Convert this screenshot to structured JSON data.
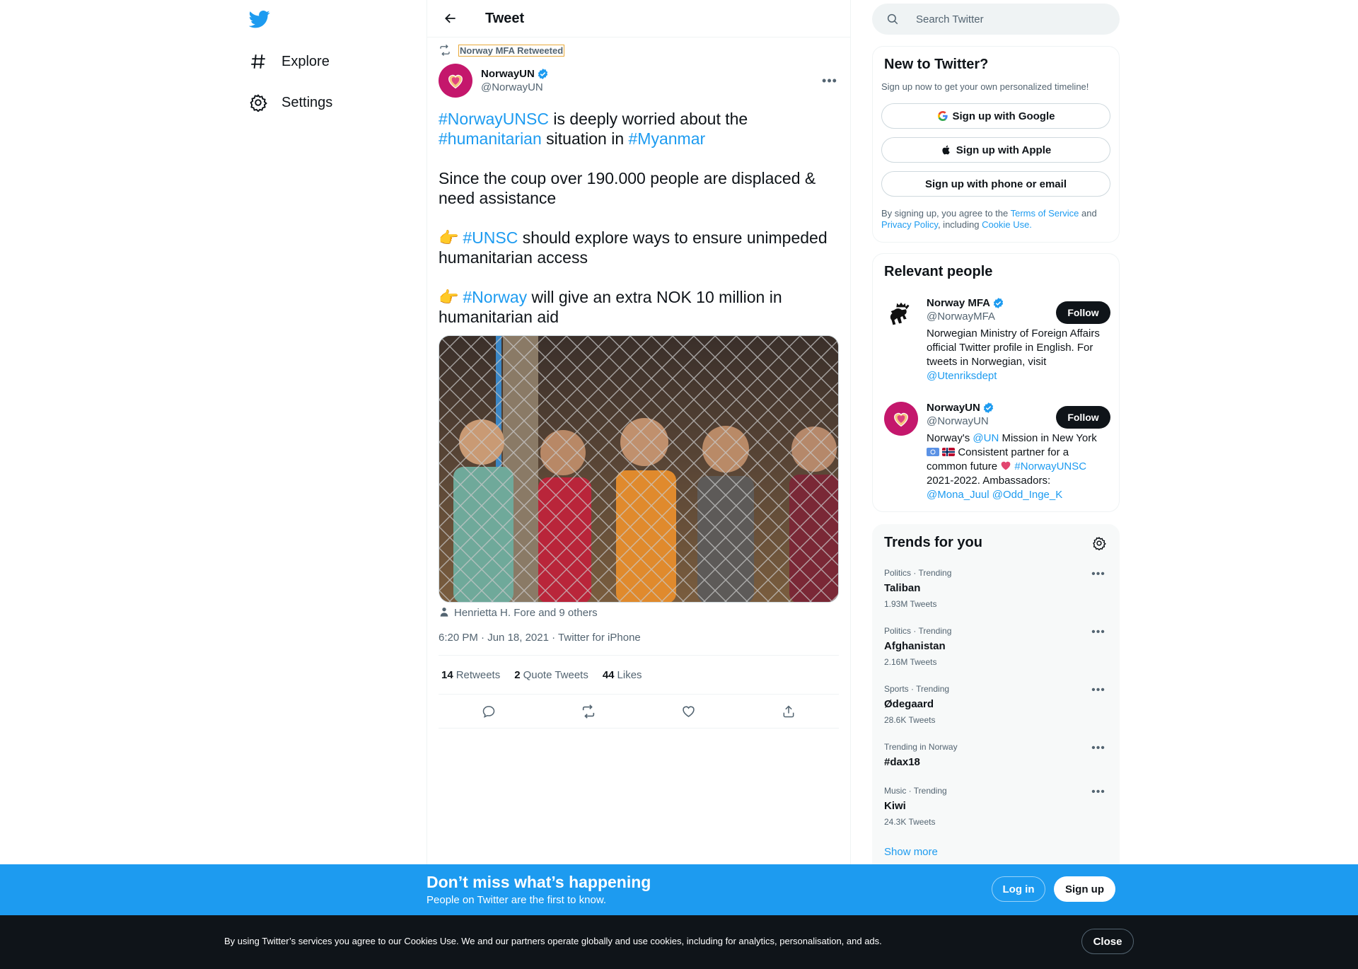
{
  "nav": {
    "logo_icon": "twitter-bird-icon",
    "items": [
      {
        "label": "Explore",
        "icon": "hashtag-icon"
      },
      {
        "label": "Settings",
        "icon": "gear-icon"
      }
    ]
  },
  "header": {
    "title": "Tweet"
  },
  "tweet": {
    "retweeted_by": "Norway MFA Retweeted",
    "author_name": "NorwayUN",
    "author_handle": "@NorwayUN",
    "para1": {
      "tag1": "#NorwayUNSC",
      "t1": " is deeply worried about the ",
      "tag2": "#humanitarian",
      "t2": " situation in ",
      "tag3": "#Myanmar"
    },
    "para2": "Since the coup over 190.000 people are displaced & need assistance",
    "para3": {
      "emoji": "👉",
      "tag": "#UNSC",
      "text": " should explore ways to ensure unimpeded humanitarian access"
    },
    "para4": {
      "emoji": "👉",
      "tag": "#Norway",
      "text": " will give an extra NOK 10 million in humanitarian aid"
    },
    "tagged": "Henrietta H. Fore and 9 others",
    "time": "6:20 PM",
    "date": "Jun 18, 2021",
    "source": "Twitter for iPhone",
    "retweets_count": "14",
    "retweets_label": "Retweets",
    "quotes_count": "2",
    "quotes_label": "Quote Tweets",
    "likes_count": "44",
    "likes_label": "Likes"
  },
  "search": {
    "placeholder": "Search Twitter"
  },
  "signup": {
    "title": "New to Twitter?",
    "subtitle": "Sign up now to get your own personalized timeline!",
    "google": "Sign up with Google",
    "apple": "Sign up with Apple",
    "phone": "Sign up with phone or email",
    "terms_pre": "By signing up, you agree to the ",
    "terms_link": "Terms of Service",
    "terms_and": " and ",
    "privacy_link": "Privacy Policy",
    "including": ", including ",
    "cookie_link": "Cookie Use."
  },
  "people": {
    "title": "Relevant people",
    "follow_label": "Follow",
    "p1": {
      "name": "Norway MFA",
      "handle": "@NorwayMFA",
      "bio": "Norwegian Ministry of Foreign Affairs official Twitter profile in English. For tweets in Norwegian, visit ",
      "bio_link": "@Utenriksdept"
    },
    "p2": {
      "name": "NorwayUN",
      "handle": "@NorwayUN",
      "bio1": "Norway's ",
      "bio_link1": "@UN",
      "bio2": " Mission in New York ",
      "bio3": " Consistent partner for a common future ",
      "bio_link2": "#NorwayUNSC",
      "bio4": " 2021-2022. Ambassadors: ",
      "bio_link3": "@Mona_Juul",
      "bio_link4": "@Odd_Inge_K"
    }
  },
  "trends": {
    "title": "Trends for you",
    "items": [
      {
        "meta": "Politics · Trending",
        "name": "Taliban",
        "count": "1.93M Tweets"
      },
      {
        "meta": "Politics · Trending",
        "name": "Afghanistan",
        "count": "2.16M Tweets"
      },
      {
        "meta": "Sports · Trending",
        "name": "Ødegaard",
        "count": "28.6K Tweets"
      },
      {
        "meta": "Trending in Norway",
        "name": "#dax18",
        "count": ""
      },
      {
        "meta": "Music · Trending",
        "name": "Kiwi",
        "count": "24.3K Tweets"
      }
    ],
    "show_more": "Show more"
  },
  "bottom_bar": {
    "title": "Don’t miss what’s happening",
    "subtitle": "People on Twitter are the first to know.",
    "login": "Log in",
    "signup": "Sign up"
  },
  "cookie": {
    "text": "By using Twitter’s services you agree to our Cookies Use. We and our partners operate globally and use cookies, including for analytics, personalisation, and ads.",
    "close": "Close"
  },
  "colors": {
    "accent": "#1d9bf0",
    "text": "#0f1419",
    "muted": "#536471",
    "avatar": "#c4176c"
  }
}
